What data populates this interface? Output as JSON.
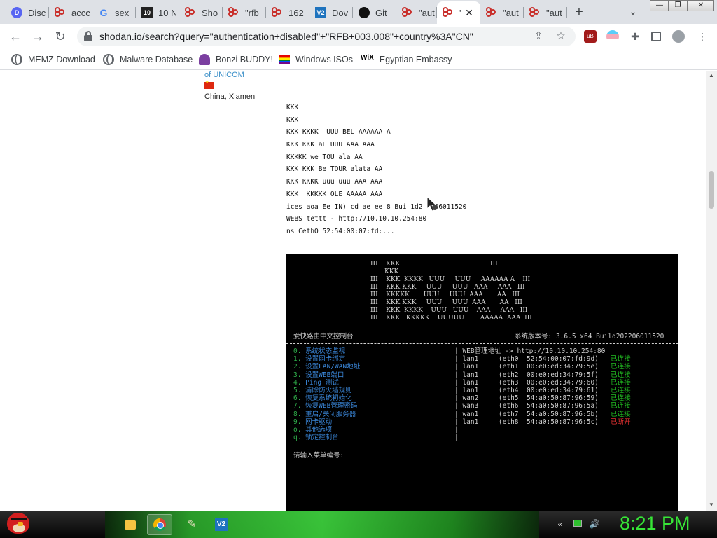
{
  "browser": {
    "tabs": [
      {
        "title": "Disc",
        "icon": "discord-icon"
      },
      {
        "title": "accc",
        "icon": "shodan-icon"
      },
      {
        "title": "sex",
        "icon": "google-icon"
      },
      {
        "title": "10 N",
        "icon": "ten-icon"
      },
      {
        "title": "Sho",
        "icon": "shodan-icon"
      },
      {
        "title": "\"rfb",
        "icon": "shodan-icon"
      },
      {
        "title": "162",
        "icon": "shodan-icon"
      },
      {
        "title": "Dov",
        "icon": "v2-icon"
      },
      {
        "title": "Git",
        "icon": "github-icon"
      },
      {
        "title": "\"aut",
        "icon": "shodan-icon"
      },
      {
        "title": "'",
        "icon": "shodan-icon",
        "active": true
      },
      {
        "title": "\"aut",
        "icon": "shodan-icon"
      },
      {
        "title": "\"aut",
        "icon": "shodan-icon"
      }
    ],
    "icons": {
      "discord_glyph": "D",
      "google_glyph": "G",
      "ten_glyph": "10",
      "v2_glyph": "V2"
    },
    "url": "shodan.io/search?query=\"authentication+disabled\"+\"RFB+003.008\"+country%3A\"CN\"",
    "bookmarks": [
      {
        "label": "MEMZ Download",
        "icon": "globe-icon"
      },
      {
        "label": "Malware Database",
        "icon": "globe-icon"
      },
      {
        "label": "Bonzi BUDDY!",
        "icon": "bonzi-icon"
      },
      {
        "label": "Windows ISOs",
        "icon": "rainbow-flag-icon"
      },
      {
        "label": "Egyptian Embassy",
        "icon": "wix-icon"
      }
    ],
    "wix_glyph": "WiX"
  },
  "result": {
    "isp": "of UNICOM",
    "location": "China, Xiamen",
    "banner_lines": [
      "KKK",
      "KKK",
      "KKK KKKK  UUU BEL AAAAAA A",
      "KKK KKK aL UUU AAA AAA",
      "KKKKK we TOU ala AA",
      "KKK KKK Be TOUR alata AA",
      "KKK KKKK uuu uuu AAA AAA",
      "KKK  KKKKK OLE AAAAA AAA",
      "ices aoa Ee IN) cd ae ee 8 Bui 1d2  206011520",
      "WEBS tettt - http:7710.10.10.254:80",
      "ns CethO 52:54:00:07:fd:..."
    ]
  },
  "screenshot": {
    "ascii_art": [
      "III    KKK                                             III",
      "       KKK",
      "III    KKK  KKKK   UUU     UUU     AAAAAA A    III",
      "III    KKK KKK     UUU     UUU   AAA     AAA   III",
      "III    KKKKK       UUU     UUU  AAA       AA   III",
      "III    KKK KKK     UUU     UUU  AAA       AA   III",
      "III    KKK  KKKK    UUU   UUU    AAA     AAA   III",
      "III    KKK   KKKKK    UUUUU        AAAAA  AAA  III"
    ],
    "console_title": "爱快路由中文控制台",
    "version": "系统版本号: 3.6.5 x64 Build202206011520",
    "menu": [
      {
        "num": "0.",
        "label": "系统状态监视"
      },
      {
        "num": "1.",
        "label": "设置网卡绑定"
      },
      {
        "num": "2.",
        "label": "设置LAN/WAN地址"
      },
      {
        "num": "3.",
        "label": "设置WEB端口"
      },
      {
        "num": "4.",
        "label": "Ping 测试"
      },
      {
        "num": "5.",
        "label": "清除防火墙规则"
      },
      {
        "num": "6.",
        "label": "恢复系统初始化"
      },
      {
        "num": "7.",
        "label": "恢复WEB管理密码"
      },
      {
        "num": "8.",
        "label": "重启/关闭服务器"
      },
      {
        "num": "9.",
        "label": "网卡驱动"
      },
      {
        "num": "o.",
        "label": "其他选项"
      },
      {
        "num": "q.",
        "label": "锁定控制台"
      }
    ],
    "web_addr": "| WEB管理地址 -> http://10.10.10.254:80",
    "interfaces": [
      {
        "net": "| lan1",
        "eth": "(eth0  52:54:00:07:fd:9d)",
        "status": "已连接",
        "ok": true
      },
      {
        "net": "| lan1",
        "eth": "(eth1  00:e0:ed:34:79:5e)",
        "status": "已连接",
        "ok": true
      },
      {
        "net": "| lan1",
        "eth": "(eth2  00:e0:ed:34:79:5f)",
        "status": "已连接",
        "ok": true
      },
      {
        "net": "| lan1",
        "eth": "(eth3  00:e0:ed:34:79:60)",
        "status": "已连接",
        "ok": true
      },
      {
        "net": "| lan1",
        "eth": "(eth4  00:e0:ed:34:79:61)",
        "status": "已连接",
        "ok": true
      },
      {
        "net": "| wan2",
        "eth": "(eth5  54:a0:50:87:96:59)",
        "status": "已连接",
        "ok": true
      },
      {
        "net": "| wan3",
        "eth": "(eth6  54:a0:50:87:96:5a)",
        "status": "已连接",
        "ok": true
      },
      {
        "net": "| wan1",
        "eth": "(eth7  54:a0:50:87:96:5b)",
        "status": "已连接",
        "ok": true
      },
      {
        "net": "| lan1",
        "eth": "(eth8  54:a0:50:87:96:5c)",
        "status": "已断开",
        "ok": false
      },
      {
        "net": "|",
        "eth": "",
        "status": "",
        "ok": true
      },
      {
        "net": "|",
        "eth": "",
        "status": "",
        "ok": true
      }
    ],
    "prompt": "请输入菜单编号:"
  },
  "taskbar": {
    "clock": "8:21 PM",
    "v2_glyph": "V2"
  },
  "colors": {
    "accent_green": "#37e637",
    "status_ok": "#22c022",
    "status_bad": "#e03030"
  }
}
